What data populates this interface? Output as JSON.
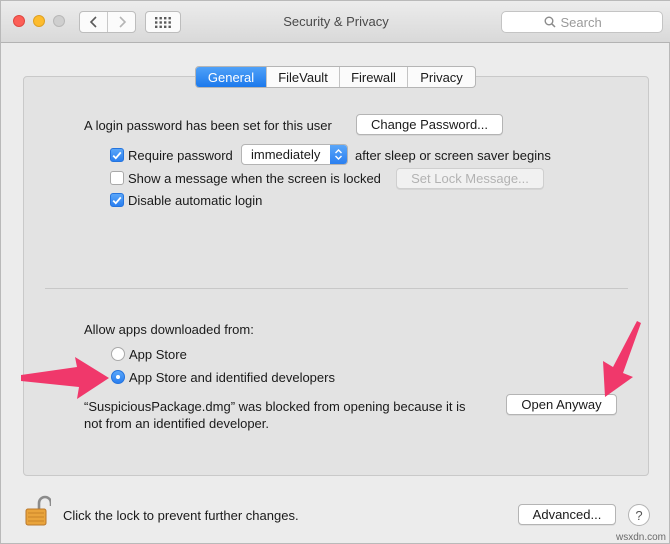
{
  "window": {
    "title": "Security & Privacy",
    "traffic_lights": [
      "close",
      "minimize",
      "zoom"
    ],
    "nav": {
      "back_icon": "chevron-left-icon",
      "forward_icon": "chevron-right-icon",
      "grid_icon": "grid-icon"
    },
    "search": {
      "placeholder": "Search",
      "icon": "search-icon"
    }
  },
  "tabs": [
    {
      "label": "General",
      "active": true
    },
    {
      "label": "FileVault",
      "active": false
    },
    {
      "label": "Firewall",
      "active": false
    },
    {
      "label": "Privacy",
      "active": false
    }
  ],
  "general": {
    "login_password_text": "A login password has been set for this user",
    "change_password_label": "Change Password...",
    "require_password": {
      "label": "Require password",
      "checked": true,
      "select_value": "immediately",
      "after_text": "after sleep or screen saver begins"
    },
    "show_message": {
      "label": "Show a message when the screen is locked",
      "checked": false,
      "button_label": "Set Lock Message..."
    },
    "disable_auto_login": {
      "label": "Disable automatic login",
      "checked": true
    },
    "allow_apps": {
      "heading": "Allow apps downloaded from:",
      "options": [
        {
          "label": "App Store",
          "selected": false
        },
        {
          "label": "App Store and identified developers",
          "selected": true
        }
      ]
    },
    "blocked": {
      "line1": "“SuspiciousPackage.dmg” was blocked from opening because it is",
      "line2": "not from an identified developer.",
      "open_anyway_label": "Open Anyway"
    }
  },
  "footer": {
    "lock_icon": "lock-open-icon",
    "lock_text": "Click the lock to prevent further changes.",
    "advanced_label": "Advanced...",
    "help_label": "?"
  },
  "annotations": {
    "arrow_color": "#f0386b"
  },
  "watermark": "wsxdn.com"
}
